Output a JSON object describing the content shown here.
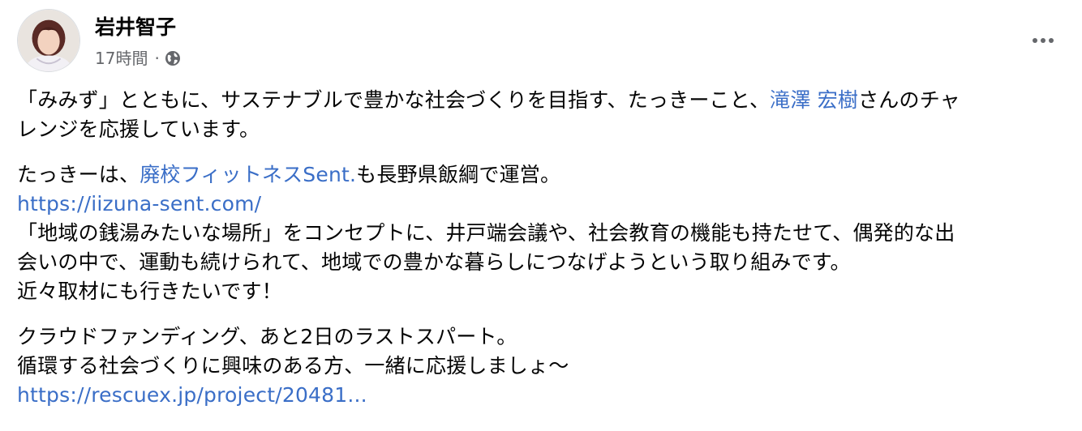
{
  "post": {
    "author": "岩井智子",
    "time": "17時間",
    "separator": "·",
    "privacy_icon": "globe-icon",
    "more_icon": "ellipsis-icon"
  },
  "body": {
    "p1": {
      "line1_a": "「みみず」とともに、サステナブルで豊かな社会づくりを目指す、たっきーこと、",
      "mention": "滝澤 宏樹",
      "line1_b": "さんのチャ",
      "line2": "レンジを応援しています。"
    },
    "p2": {
      "line1_a": "たっきーは、",
      "page_link": "廃校フィットネスSent.",
      "line1_b": "も長野県飯綱で運営。",
      "url": "https://iizuna-sent.com/",
      "line3": "「地域の銭湯みたいな場所」をコンセプトに、井戸端会議や、社会教育の機能も持たせて、偶発的な出",
      "line4": "会いの中で、運動も続けられて、地域での豊かな暮らしにつなげようという取り組みです。",
      "line5": "近々取材にも行きたいです！"
    },
    "p3": {
      "line1": "クラウドファンディング、あと2日のラストスパート。",
      "line2": "循環する社会づくりに興味のある方、一緒に応援しましょ〜",
      "url": "https://rescuex.jp/project/20481..."
    }
  },
  "colors": {
    "link": "#3a6ec7",
    "text": "#050505",
    "secondary": "#65676b"
  }
}
